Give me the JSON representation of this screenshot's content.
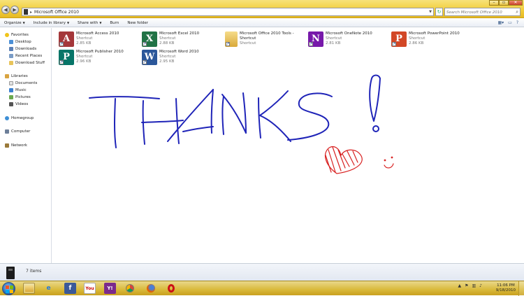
{
  "window": {
    "breadcrumb": "Microsoft Office 2010",
    "search_placeholder": "Search Microsoft Office 2010"
  },
  "toolbar": {
    "organize": "Organize",
    "include_in_library": "Include in library",
    "share_with": "Share with",
    "burn": "Burn",
    "new_folder": "New folder"
  },
  "sidebar": {
    "favorites": "Favorites",
    "favorites_items": [
      "Desktop",
      "Downloads",
      "Recent Places",
      "Download Stuff"
    ],
    "libraries": "Libraries",
    "libraries_items": [
      "Documents",
      "Music",
      "Pictures",
      "Videos"
    ],
    "homegroup": "Homegroup",
    "computer": "Computer",
    "network": "Network"
  },
  "files": [
    {
      "name": "Microsoft Access 2010",
      "type": "Shortcut",
      "size": "2.85 KB",
      "icon": "access-icon",
      "color": "#a4373a",
      "letter": "A"
    },
    {
      "name": "Microsoft Excel 2010",
      "type": "Shortcut",
      "size": "2.88 KB",
      "icon": "excel-icon",
      "color": "#217346",
      "letter": "X"
    },
    {
      "name": "Microsoft Office 2010 Tools - Shortcut",
      "type": "Shortcut",
      "size": "",
      "icon": "folder-icon",
      "color": "#e8c45a",
      "letter": ""
    },
    {
      "name": "Microsoft OneNote 2010",
      "type": "Shortcut",
      "size": "2.81 KB",
      "icon": "onenote-icon",
      "color": "#7719aa",
      "letter": "N"
    },
    {
      "name": "Microsoft PowerPoint 2010",
      "type": "Shortcut",
      "size": "2.86 KB",
      "icon": "powerpoint-icon",
      "color": "#d24726",
      "letter": "P"
    },
    {
      "name": "Microsoft Publisher 2010",
      "type": "Shortcut",
      "size": "2.96 KB",
      "icon": "publisher-icon",
      "color": "#077568",
      "letter": "P"
    },
    {
      "name": "Microsoft Word 2010",
      "type": "Shortcut",
      "size": "2.95 KB",
      "icon": "word-icon",
      "color": "#2b579a",
      "letter": "W"
    }
  ],
  "status": {
    "item_count": "7 items"
  },
  "taskbar": {
    "time": "11:06 PM",
    "date": "9/18/2010"
  },
  "colors": {
    "ink_blue": "#1f24b8",
    "ink_red": "#d82020"
  }
}
